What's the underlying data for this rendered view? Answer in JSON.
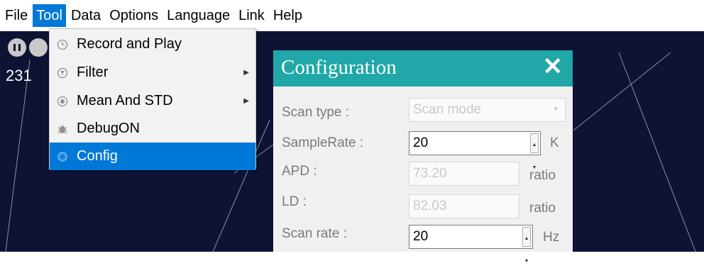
{
  "menubar": {
    "items": [
      "File",
      "Tool",
      "Data",
      "Options",
      "Language",
      "Link",
      "Help"
    ],
    "active": "Tool"
  },
  "canvas": {
    "counter_text": "231"
  },
  "tool_menu": {
    "items": [
      {
        "label": "Record and Play",
        "icon": "clock-icon",
        "has_submenu": false
      },
      {
        "label": "Filter",
        "icon": "filter-icon",
        "has_submenu": true
      },
      {
        "label": "Mean And STD",
        "icon": "stats-icon",
        "has_submenu": true
      },
      {
        "label": "DebugON",
        "icon": "bug-icon",
        "has_submenu": false
      },
      {
        "label": "Config",
        "icon": "gear-icon",
        "has_submenu": false
      }
    ],
    "selected": "Config"
  },
  "config_dialog": {
    "title": "Configuration",
    "close_glyph": "✕",
    "fields": {
      "scan_type": {
        "label": "Scan type :",
        "value": "Scan mode",
        "unit": ""
      },
      "sample_rate": {
        "label": "SampleRate :",
        "value": "20",
        "unit": "K"
      },
      "apd": {
        "label": "APD :",
        "value": "73.20",
        "unit": "ratio"
      },
      "ld": {
        "label": "LD :",
        "value": "82.03",
        "unit": "ratio"
      },
      "scan_rate": {
        "label": "Scan rate :",
        "value": "20",
        "unit": "Hz"
      }
    }
  },
  "colors": {
    "accent": "#0078d7",
    "dialog_title": "#21a7a8",
    "canvas_bg": "#0e1334"
  }
}
